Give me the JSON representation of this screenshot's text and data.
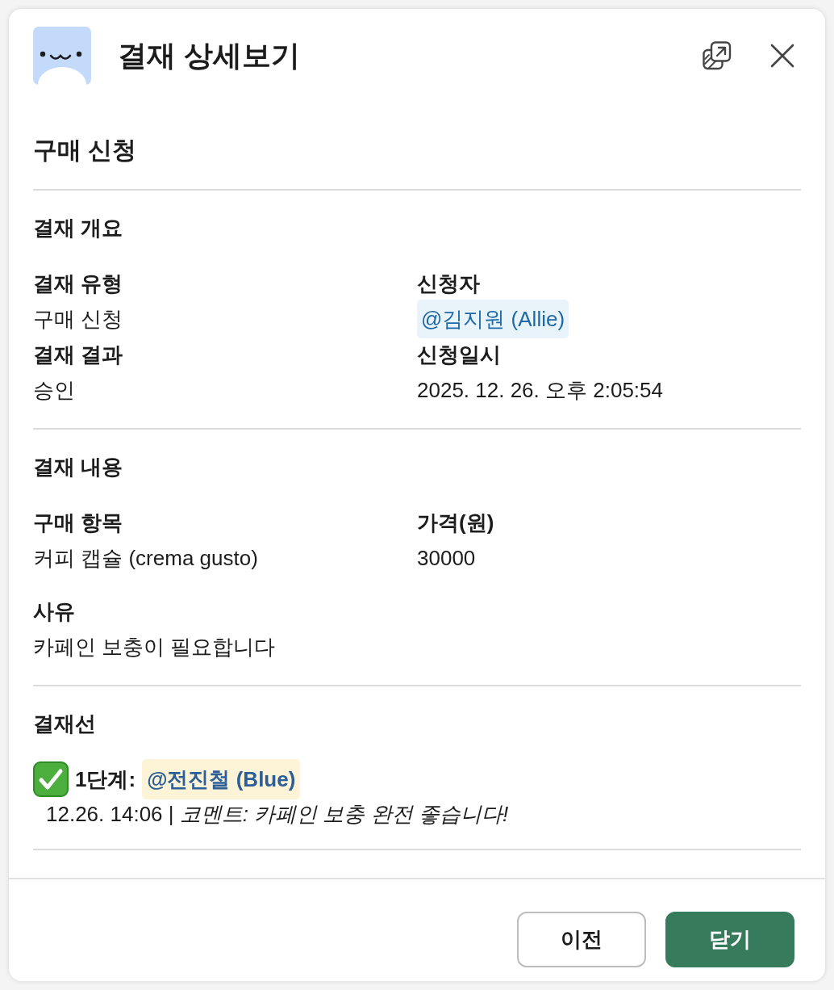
{
  "header": {
    "title": "결재 상세보기"
  },
  "form_title": "구매 신청",
  "sections": [
    {
      "heading": "결재 개요",
      "blocks": [
        {
          "fields": [
            {
              "label": "결재 유형",
              "value": "구매 신청",
              "kind": "text"
            },
            {
              "label": "신청자",
              "value": "@김지원 (Allie)",
              "kind": "mention"
            },
            {
              "label": "결재 결과",
              "value": "승인",
              "kind": "text"
            },
            {
              "label": "신청일시",
              "value": "2025. 12. 26. 오후 2:05:54",
              "kind": "text"
            }
          ]
        }
      ]
    },
    {
      "heading": "결재 내용",
      "blocks": [
        {
          "fields": [
            {
              "label": "구매 항목",
              "value": "커피 캡슐 (crema gusto)",
              "kind": "text"
            },
            {
              "label": "가격(원)",
              "value": "30000",
              "kind": "text"
            }
          ]
        },
        {
          "fields": [
            {
              "label": "사유",
              "value": "카페인 보충이 필요합니다",
              "kind": "text"
            }
          ]
        }
      ]
    }
  ],
  "approval_line": {
    "heading": "결재선",
    "steps": [
      {
        "checked": true,
        "label": "1단계:",
        "approver": "@전진철 (Blue)",
        "detail": "12.26. 14:06 | *코멘트: 카페인 보충 완전 좋습니다!*"
      }
    ]
  },
  "buttons": [
    {
      "label": "이전",
      "kind": "secondary"
    },
    {
      "label": "닫기",
      "kind": "primary"
    }
  ]
}
